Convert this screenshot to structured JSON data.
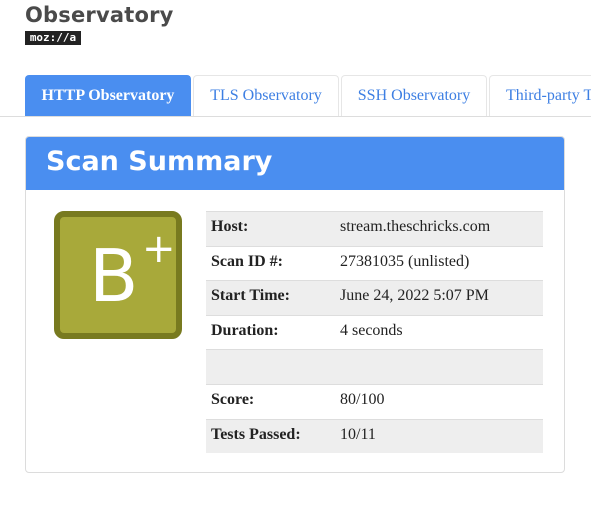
{
  "logo": {
    "title": "Observatory",
    "badge": "moz://a"
  },
  "tabs": [
    {
      "label": "HTTP Observatory",
      "active": true
    },
    {
      "label": "TLS Observatory",
      "active": false
    },
    {
      "label": "SSH Observatory",
      "active": false
    },
    {
      "label": "Third-party Tests",
      "active": false
    }
  ],
  "panel": {
    "title": "Scan Summary"
  },
  "grade": {
    "letter": "B",
    "modifier": "+",
    "color": "#a8a93a",
    "border_color": "#787a1f"
  },
  "summary": {
    "host_label": "Host:",
    "host_value": "stream.theschricks.com",
    "scan_id_label": "Scan ID #:",
    "scan_id_value": "27381035 (unlisted)",
    "start_time_label": "Start Time:",
    "start_time_value": "June 24, 2022 5:07 PM",
    "duration_label": "Duration:",
    "duration_value": "4 seconds",
    "score_label": "Score:",
    "score_value": "80/100",
    "tests_passed_label": "Tests Passed:",
    "tests_passed_value": "10/11"
  },
  "colors": {
    "accent": "#4a8ef0",
    "link": "#3d7fe3"
  }
}
